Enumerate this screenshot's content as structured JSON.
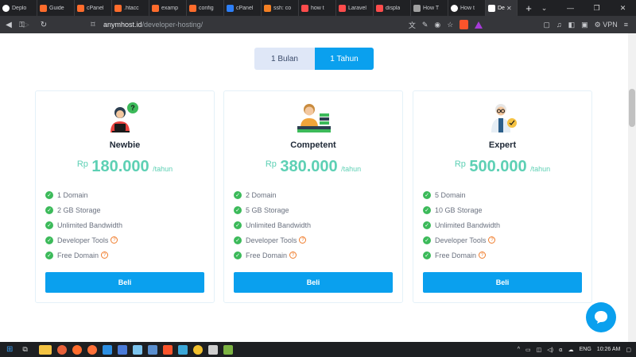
{
  "browser": {
    "tabs": [
      {
        "label": "Deplo",
        "color": "#ffffff"
      },
      {
        "label": "Guide",
        "color": "#ff6c2c"
      },
      {
        "label": "cPanel",
        "color": "#ff6c2c"
      },
      {
        "label": ".htacc",
        "color": "#ff6c2c"
      },
      {
        "label": "examp",
        "color": "#ff6c2c"
      },
      {
        "label": "config",
        "color": "#ff6c2c"
      },
      {
        "label": "cPanel",
        "color": "#2d7ff9"
      },
      {
        "label": "ssh: co",
        "color": "#f48024"
      },
      {
        "label": "how t",
        "color": "#ff4c4c"
      },
      {
        "label": "Laravel",
        "color": "#ff4c4c"
      },
      {
        "label": "displa",
        "color": "#ff4c4c"
      },
      {
        "label": "How T",
        "color": "#a0a0a0"
      },
      {
        "label": "How t",
        "color": "#ffffff"
      },
      {
        "label": "De",
        "color": "#ffffff"
      }
    ],
    "url_host": "anymhost.id",
    "url_path": "/developer-hosting/",
    "vpn_label": "VPN"
  },
  "billing_toggle": {
    "option_monthly": "1 Bulan",
    "option_yearly": "1 Tahun",
    "selected": "1 Tahun"
  },
  "plans": [
    {
      "name": "Newbie",
      "currency": "Rp",
      "price": "180.000",
      "period": "/tahun",
      "features": [
        "1 Domain",
        "2 GB Storage",
        "Unlimited Bandwidth",
        "Developer Tools",
        "Free Domain"
      ],
      "buy_label": "Beli"
    },
    {
      "name": "Competent",
      "currency": "Rp",
      "price": "380.000",
      "period": "/tahun",
      "features": [
        "2 Domain",
        "5 GB Storage",
        "Unlimited Bandwidth",
        "Developer Tools",
        "Free Domain"
      ],
      "buy_label": "Beli"
    },
    {
      "name": "Expert",
      "currency": "Rp",
      "price": "500.000",
      "period": "/tahun",
      "features": [
        "5 Domain",
        "10 GB Storage",
        "Unlimited Bandwidth",
        "Developer Tools",
        "Free Domain"
      ],
      "buy_label": "Beli"
    }
  ],
  "taskbar": {
    "language": "ENG",
    "time": "10:26 AM"
  },
  "colors": {
    "accent": "#0aa0ee",
    "price": "#5dd0b4",
    "check": "#3cba5a",
    "help": "#f07c2b"
  }
}
